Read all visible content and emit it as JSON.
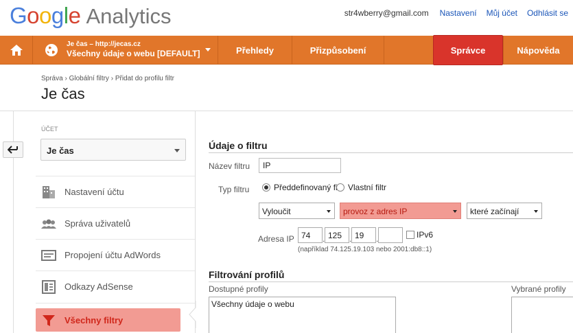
{
  "header": {
    "product": "Analytics",
    "user_email": "str4wberry@gmail.com",
    "links": [
      "Nastavení",
      "Můj účet",
      "Odhlásit se"
    ]
  },
  "nav": {
    "profile_url": "Je čas – http://jecas.cz",
    "profile_name": "Všechny údaje o webu [DEFAULT]",
    "items": [
      "Přehledy",
      "Přizpůsobení",
      "Správce",
      "Nápověda"
    ],
    "active": "Správce"
  },
  "breadcrumb": "Správa › Globální filtry › Přidat do profilu filtr",
  "page_title": "Je čas",
  "sidebar": {
    "account_label": "ÚČET",
    "account_value": "Je čas",
    "items": [
      {
        "label": "Nastavení účtu",
        "icon": "building-icon"
      },
      {
        "label": "Správa uživatelů",
        "icon": "users-icon"
      },
      {
        "label": "Propojení účtu AdWords",
        "icon": "adwords-icon"
      },
      {
        "label": "Odkazy AdSense",
        "icon": "adsense-icon"
      },
      {
        "label": "Všechny filtry",
        "icon": "filter-icon",
        "active": true
      }
    ]
  },
  "filter": {
    "section_title": "Údaje o filtru",
    "name_label": "Název filtru",
    "name_value": "IP",
    "type_label": "Typ filtru",
    "type_options": [
      "Předdefinovaný filtr",
      "Vlastní filtr"
    ],
    "type_selected": "Předdefinovaný filtr",
    "action": "Vyloučit",
    "source": "provoz z adres IP",
    "match": "které začínají",
    "address_label": "Adresa IP",
    "octets": [
      "74",
      "125",
      "19",
      ""
    ],
    "ipv6_label": "IPv6",
    "ipv6_checked": false,
    "hint": "(například 74.125.19.103 nebo 2001:db8::1)"
  },
  "profiles": {
    "section_title": "Filtrování profilů",
    "available_label": "Dostupné profily",
    "selected_label": "Vybrané profily",
    "available": [
      "Všechny údaje o webu"
    ],
    "selected": []
  },
  "colors": {
    "nav_bg": "#e1762a",
    "active_nav": "#d9342b",
    "active_sidebar": "#f29b93",
    "link": "#1a55b8"
  }
}
